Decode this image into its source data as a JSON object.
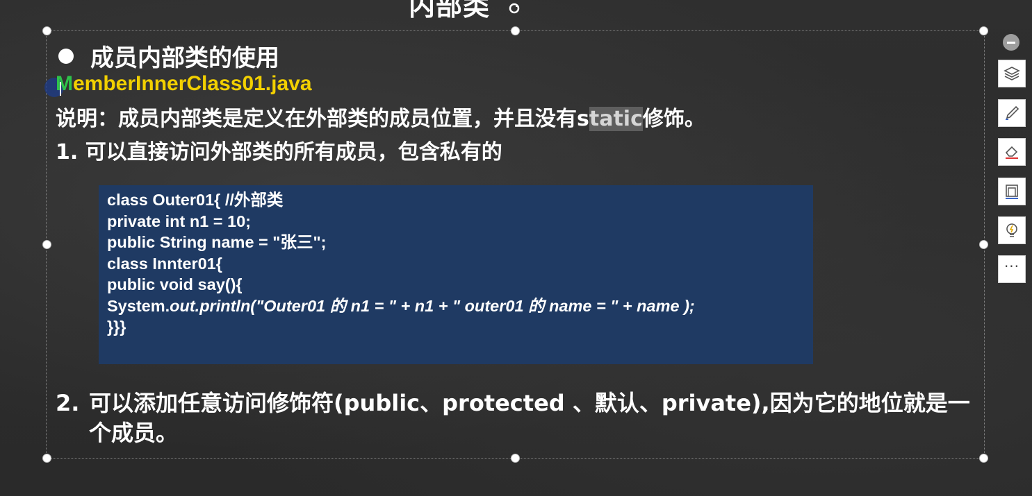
{
  "slide": {
    "title": "内部类",
    "heading": "成员内部类的使用",
    "filename_first_char": "M",
    "filename_rest": "emberInnerClass01.java",
    "description_before": "说明：成员内部类是定义在外部类的成员位置，并且没有s",
    "description_highlight": "tatic",
    "description_after": "修饰。",
    "point1": "1. 可以直接访问外部类的所有成员，包含私有的",
    "code_lines": [
      "class Outer01{ //外部类",
      "private int n1 = 10;",
      "public String name = \"张三\";",
      "class Innter01{",
      "public void say(){",
      "System.",
      "}}}"
    ],
    "code_line6_italic": "out.println(\"Outer01 的 n1 = \" + n1 + \" outer01 的 name = \" + name );",
    "point2_num": "2.",
    "point2_text": "可以添加任意访问修饰符(public、protected 、默认、private),因为它的地位就是一个成员。"
  },
  "toolbar": {
    "more_label": "···",
    "icons": [
      "collapse-icon",
      "layers-icon",
      "pen-icon",
      "eraser-icon",
      "frame-icon",
      "lightbulb-icon",
      "more-icon"
    ]
  },
  "colors": {
    "filename_green": "#2ec24a",
    "filename_yellow": "#f2d000",
    "code_background": "#1f3a63",
    "chalkboard": "#2d2d2d"
  }
}
